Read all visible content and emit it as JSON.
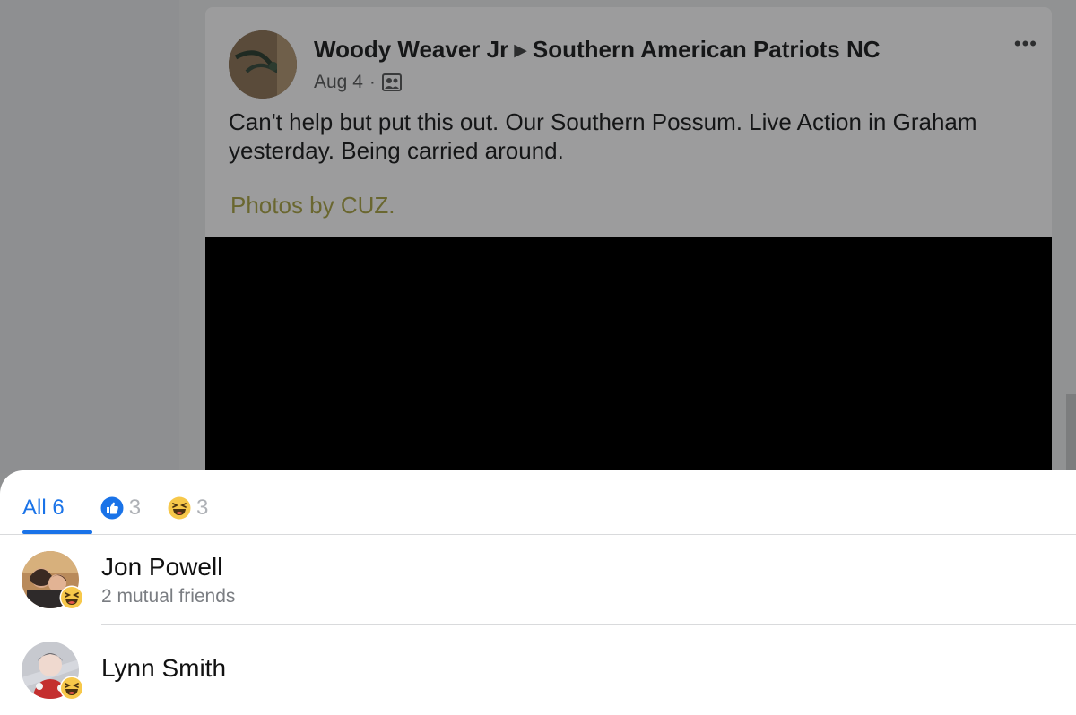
{
  "post": {
    "author": "Woody Weaver Jr",
    "group": "Southern American Patriots NC",
    "date": "Aug 4",
    "separator": "·",
    "arrow": "▶",
    "more": "•••",
    "text": "Can't help but put this out.  Our Southern Possum. Live Action in Graham yesterday. Being carried around.",
    "credit": "Photos by CUZ."
  },
  "reactions": {
    "tabs": [
      {
        "label": "All 6"
      },
      {
        "icon": "like-icon",
        "count": "3"
      },
      {
        "icon": "haha-icon",
        "count": "3"
      }
    ],
    "people": [
      {
        "name": "Jon Powell",
        "subtitle": "2 mutual friends",
        "reaction": "haha-icon"
      },
      {
        "name": "Lynn Smith",
        "subtitle": "",
        "reaction": "haha-icon"
      }
    ]
  },
  "colors": {
    "accent": "#1a73e8",
    "highlight": "#f2e96b",
    "haha_yellow": "#f7c84a"
  }
}
